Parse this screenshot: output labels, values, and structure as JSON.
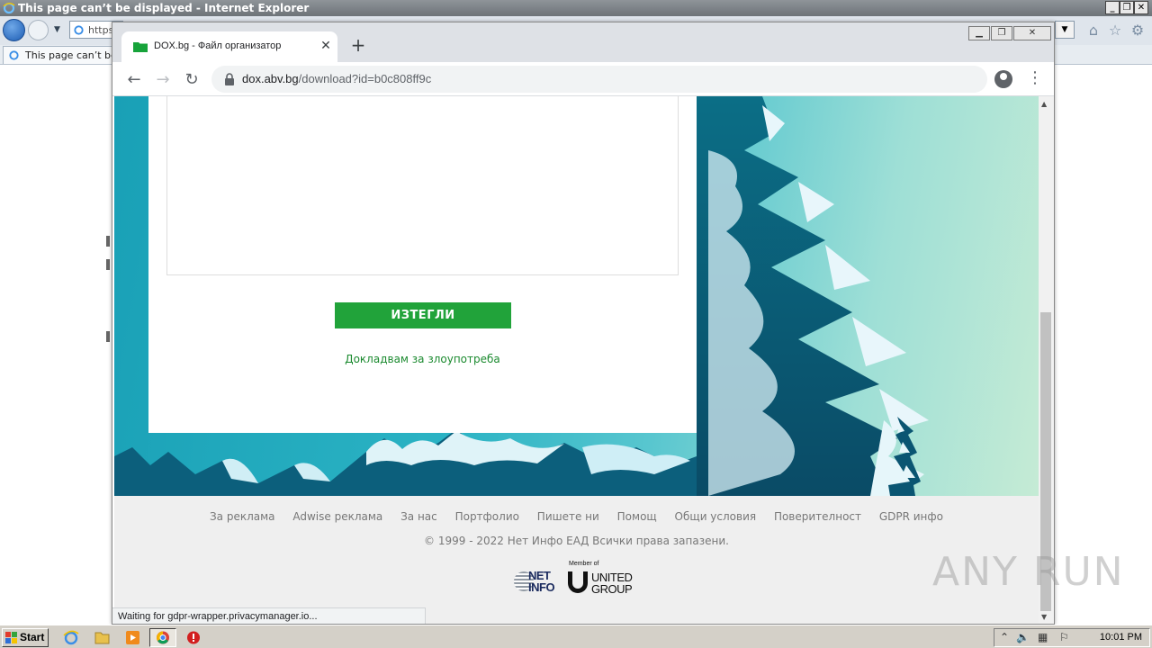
{
  "ie": {
    "title": "This page can’t be displayed - Internet Explorer",
    "address_partial": "https:",
    "tab_label": "This page can’t be d"
  },
  "chrome": {
    "tab_title": "DOX.bg - Файл организатор",
    "url_host": "dox.abv.bg",
    "url_path": "/download?id=b0c808ff9c",
    "status_text": "Waiting for gdpr-wrapper.privacymanager.io..."
  },
  "page": {
    "download_button": "ИЗТЕГЛИ",
    "report_link": "Докладвам за злоупотреба",
    "footer_links": [
      "За реклама",
      "Adwise реклама",
      "За нас",
      "Портфолио",
      "Пишете ни",
      "Помощ",
      "Общи условия",
      "Поверителност",
      "GDPR инфо"
    ],
    "copyright": "© 1999 - 2022 Нет Инфо ЕАД Всички права запазени.",
    "logo_netinfo_line1": "NET",
    "logo_netinfo_line2": "INFO",
    "logo_ug_member": "Member of",
    "logo_ug_line1": "UNITED",
    "logo_ug_line2": "GROUP"
  },
  "watermark": "ANY RUN",
  "taskbar": {
    "start_label": "Start",
    "clock": "10:01 PM"
  },
  "colors": {
    "accent_green": "#21a33a",
    "link_green": "#1b8a2f",
    "sky_teal": "#2bb3c4"
  }
}
